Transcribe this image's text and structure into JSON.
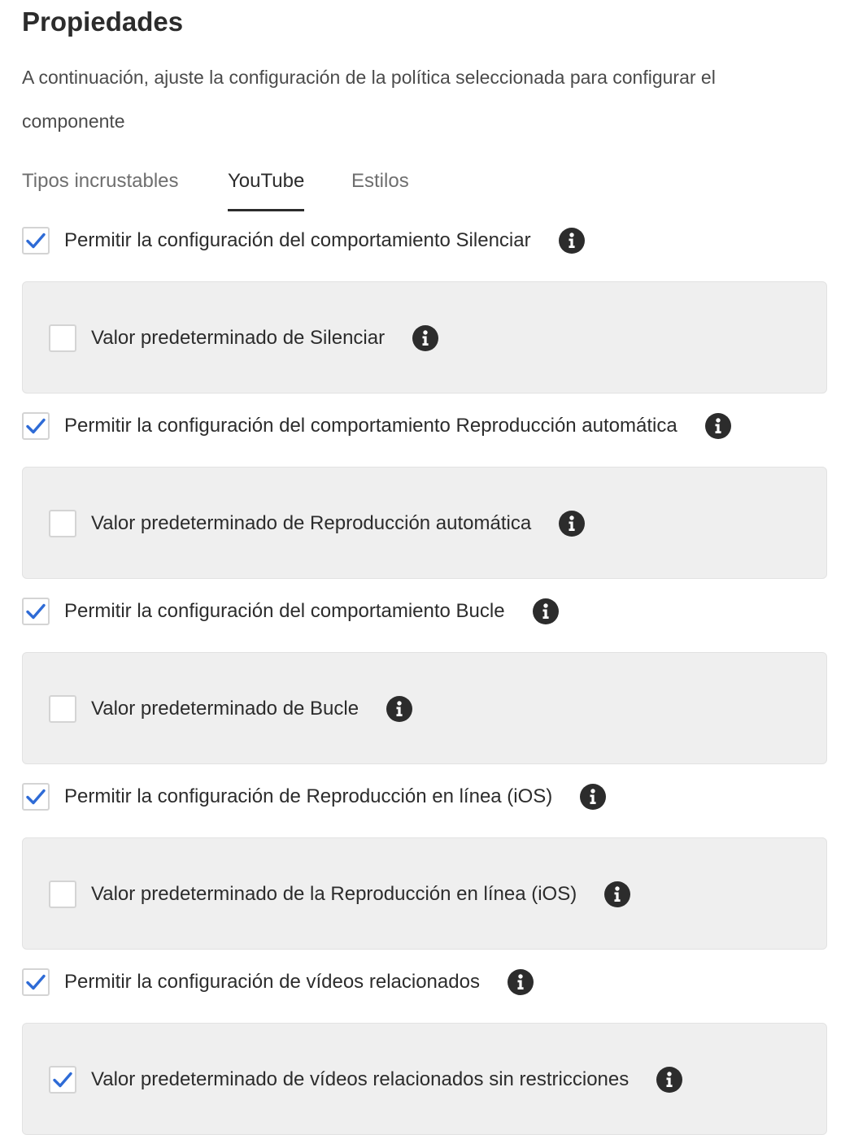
{
  "heading": "Propiedades",
  "description": "A continuación, ajuste la configuración de la política seleccionada para configurar el componente",
  "tabs": [
    {
      "label": "Tipos incrustables",
      "active": false
    },
    {
      "label": "YouTube",
      "active": true
    },
    {
      "label": "Estilos",
      "active": false
    }
  ],
  "settings": [
    {
      "allow_label": "Permitir la configuración del comportamiento Silenciar",
      "allow_checked": true,
      "default_label": "Valor predeterminado de Silenciar",
      "default_checked": false
    },
    {
      "allow_label": "Permitir la configuración del comportamiento Reproducción automática",
      "allow_checked": true,
      "default_label": "Valor predeterminado de Reproducción automática",
      "default_checked": false
    },
    {
      "allow_label": "Permitir la configuración del comportamiento Bucle",
      "allow_checked": true,
      "default_label": "Valor predeterminado de Bucle",
      "default_checked": false
    },
    {
      "allow_label": "Permitir la configuración de Reproducción en línea (iOS)",
      "allow_checked": true,
      "default_label": "Valor predeterminado de la Reproducción en línea (iOS)",
      "default_checked": false
    },
    {
      "allow_label": "Permitir la configuración de vídeos relacionados",
      "allow_checked": true,
      "default_label": "Valor predeterminado de vídeos relacionados sin restricciones",
      "default_checked": true
    }
  ],
  "colors": {
    "check": "#2e6bd6",
    "info_bg": "#2c2c2c",
    "panel_bg": "#efefef"
  },
  "icons": {
    "checkmark": "checkmark-icon",
    "info": "info-icon"
  }
}
